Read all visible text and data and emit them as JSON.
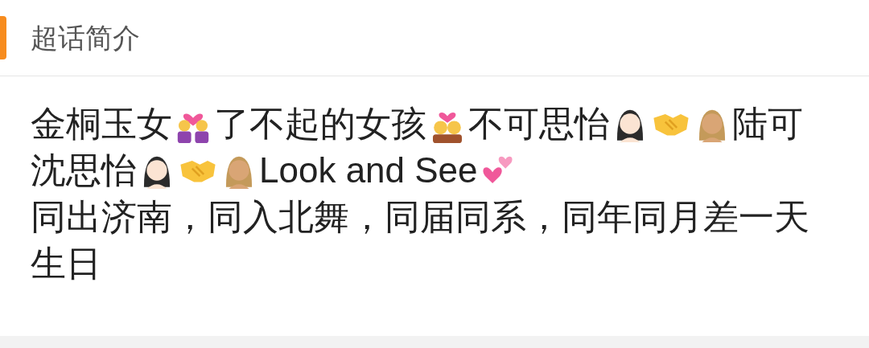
{
  "header": {
    "title": "超话简介"
  },
  "intro": {
    "lines": [
      [
        {
          "kind": "text",
          "text": "金桐玉女"
        },
        {
          "kind": "couple-heart"
        },
        {
          "kind": "text",
          "text": "了不起的女孩"
        },
        {
          "kind": "couple-kiss"
        },
        {
          "kind": "text",
          "text": "不可思怡"
        },
        {
          "kind": "woman-light"
        },
        {
          "kind": "handshake"
        },
        {
          "kind": "woman-medium"
        },
        {
          "kind": "text",
          "text": "陆可"
        }
      ],
      [
        {
          "kind": "text",
          "text": "沈思怡"
        },
        {
          "kind": "woman-light"
        },
        {
          "kind": "handshake"
        },
        {
          "kind": "woman-medium"
        },
        {
          "kind": "text",
          "text": "Look and See"
        },
        {
          "kind": "hearts"
        }
      ],
      [
        {
          "kind": "text",
          "text": "同出济南，同入北舞，同届同系，同年同月差一天"
        }
      ],
      [
        {
          "kind": "text",
          "text": "生日"
        }
      ]
    ]
  }
}
